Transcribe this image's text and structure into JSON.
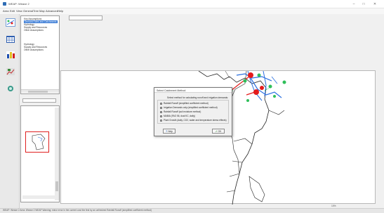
{
  "window": {
    "title": "WEAP: Weave 2",
    "minimize": "–",
    "maximize": "□",
    "close": "✕"
  },
  "menu": [
    "Area",
    "Edit",
    "View",
    "General",
    "Tree",
    "Map",
    "Advanced",
    "Help"
  ],
  "toolbar": {
    "icons": [
      "schematic-icon",
      "data-icon",
      "results-icon",
      "scenario-explorer-icon",
      "notes-icon"
    ]
  },
  "tree": {
    "items": [
      {
        "label": "Key Assumptions",
        "selected": false
      },
      {
        "label": "Demand Sites and Catchments",
        "selected": true
      },
      {
        "label": "Hydrology",
        "selected": false
      },
      {
        "label": "Supply and Resources",
        "selected": false
      },
      {
        "label": "Other Assumptions",
        "selected": false
      },
      {
        "label": "Hydrology",
        "selected": false
      },
      {
        "label": "Supply and Resources",
        "selected": false
      },
      {
        "label": "Other Assumptions",
        "selected": false
      }
    ]
  },
  "dialog": {
    "title": "Select Catchment Method",
    "prompt": "Select method for calculating runoff and irrigation demands:",
    "options": [
      {
        "label": "Rainfall Runoff (simplified coefficient method)",
        "selected": true
      },
      {
        "label": "Irrigation Demands only (simplified coefficient method)",
        "selected": false
      },
      {
        "label": "Rainfall Runoff (soil moisture method)",
        "selected": false
      },
      {
        "label": "MABIA (FAO 56, dual KC, daily)",
        "selected": false
      },
      {
        "label": "Plant Growth (daily, CO2, water and temperature stress effects)",
        "selected": false
      }
    ],
    "help_label": "Help",
    "ok_label": "OK"
  },
  "status": {
    "text": "WEAP: Weave 2     Area: Weave 2     WEAP Warning: minor error in the current cost the first by an unfinished Rainfall Runoff (simplified coefficient method)",
    "right": "10%"
  },
  "colors": {
    "selection": "#3477d4",
    "river": "#2a6fe0",
    "demand_node": "#e41b1b",
    "catchment_node": "#2fbf5a"
  }
}
